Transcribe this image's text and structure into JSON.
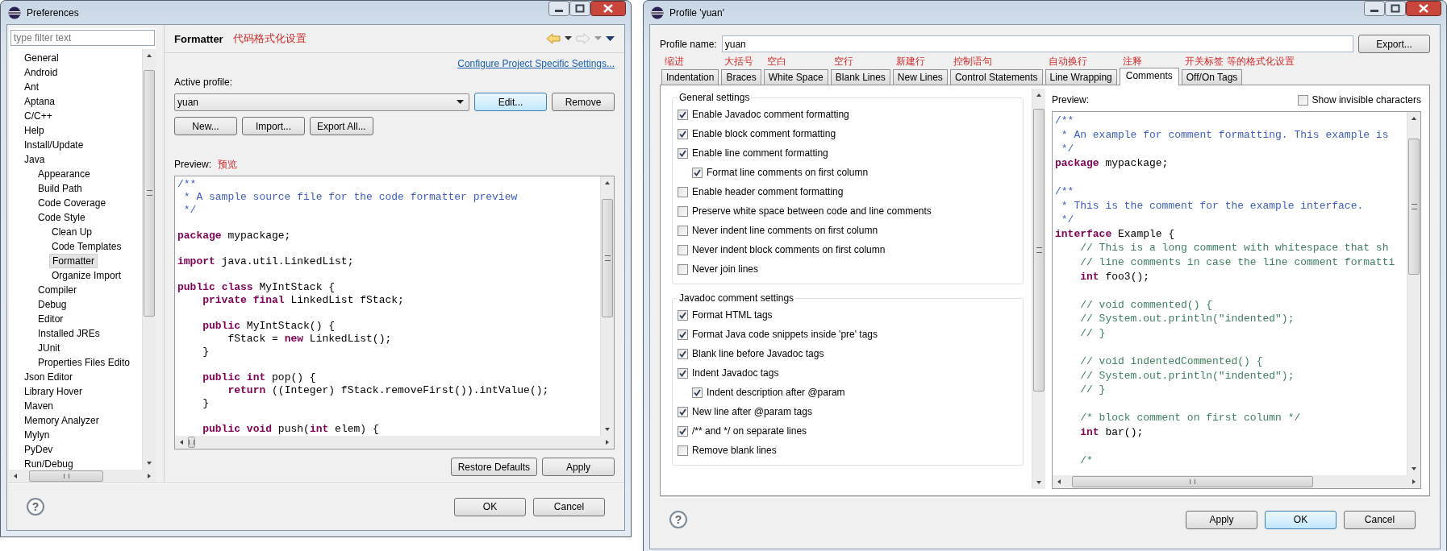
{
  "preferences": {
    "window": {
      "title": "Preferences"
    },
    "filter": {
      "placeholder": "type filter text"
    },
    "tree": [
      {
        "label": "General",
        "selected": false
      },
      {
        "label": "Android",
        "selected": false
      },
      {
        "label": "Ant",
        "selected": false
      },
      {
        "label": "Aptana",
        "selected": false
      },
      {
        "label": "C/C++",
        "selected": false
      },
      {
        "label": "Help",
        "selected": false
      },
      {
        "label": "Install/Update",
        "selected": false
      },
      {
        "label": "Java",
        "selected": false,
        "children": [
          {
            "label": "Appearance",
            "selected": false
          },
          {
            "label": "Build Path",
            "selected": false
          },
          {
            "label": "Code Coverage",
            "selected": false
          },
          {
            "label": "Code Style",
            "selected": false,
            "children": [
              {
                "label": "Clean Up",
                "selected": false
              },
              {
                "label": "Code Templates",
                "selected": false
              },
              {
                "label": "Formatter",
                "selected": true
              },
              {
                "label": "Organize Import",
                "selected": false
              }
            ]
          },
          {
            "label": "Compiler",
            "selected": false
          },
          {
            "label": "Debug",
            "selected": false
          },
          {
            "label": "Editor",
            "selected": false
          },
          {
            "label": "Installed JREs",
            "selected": false
          },
          {
            "label": "JUnit",
            "selected": false
          },
          {
            "label": "Properties Files Edito",
            "selected": false
          }
        ]
      },
      {
        "label": "Json Editor",
        "selected": false
      },
      {
        "label": "Library Hover",
        "selected": false
      },
      {
        "label": "Maven",
        "selected": false
      },
      {
        "label": "Memory Analyzer",
        "selected": false
      },
      {
        "label": "Mylyn",
        "selected": false
      },
      {
        "label": "PyDev",
        "selected": false
      },
      {
        "label": "Run/Debug",
        "selected": false
      }
    ],
    "page": {
      "title": "Formatter",
      "annotation": "代码格式化设置",
      "link": "Configure Project Specific Settings...",
      "profile_label": "Active profile:",
      "profile": "yuan",
      "profile_buttons": [
        {
          "label": "Edit...",
          "focused": true
        },
        {
          "label": "Remove",
          "focused": false
        }
      ],
      "manage_buttons": [
        "New...",
        "Import...",
        "Export All..."
      ],
      "preview_label": "Preview:",
      "preview_annotation": "预览",
      "code": [
        {
          "kind": "javadoc",
          "text": "/**"
        },
        {
          "kind": "javadoc",
          "text": " * A sample source file for the code formatter preview"
        },
        {
          "kind": "javadoc",
          "text": " */"
        },
        {
          "kind": "blank"
        },
        {
          "kind": "code",
          "text": "**package** mypackage;"
        },
        {
          "kind": "blank"
        },
        {
          "kind": "code",
          "text": "**import** java.util.LinkedList;"
        },
        {
          "kind": "blank"
        },
        {
          "kind": "code",
          "text": "**public** **class** MyIntStack {"
        },
        {
          "kind": "code",
          "text": "    **private** **final** LinkedList fStack;"
        },
        {
          "kind": "blank"
        },
        {
          "kind": "code",
          "text": "    **public** MyIntStack() {"
        },
        {
          "kind": "code",
          "text": "        fStack = **new** LinkedList();"
        },
        {
          "kind": "code",
          "text": "    }"
        },
        {
          "kind": "blank"
        },
        {
          "kind": "code",
          "text": "    **public** **int** pop() {"
        },
        {
          "kind": "code",
          "text": "        **return** ((Integer) fStack.removeFirst()).intValue();"
        },
        {
          "kind": "code",
          "text": "    }"
        },
        {
          "kind": "blank"
        },
        {
          "kind": "code",
          "text": "    **public** **void** push(**int** elem) {"
        }
      ],
      "buttons": [
        "Restore Defaults",
        "Apply"
      ]
    },
    "help": "?",
    "footer_buttons": [
      "OK",
      "Cancel"
    ]
  },
  "profile_dialog": {
    "window": {
      "title": "Profile 'yuan'"
    },
    "profile_name_label": "Profile name:",
    "profile_name": "yuan",
    "export_button": "Export...",
    "tabs": [
      {
        "label": "Indentation",
        "annotation": "缩进",
        "selected": false
      },
      {
        "label": "Braces",
        "annotation": "大括号",
        "selected": false
      },
      {
        "label": "White Space",
        "annotation": "空白",
        "selected": false
      },
      {
        "label": "Blank Lines",
        "annotation": "空行",
        "selected": false
      },
      {
        "label": "New Lines",
        "annotation": "新建行",
        "selected": false
      },
      {
        "label": "Control Statements",
        "annotation": "控制语句",
        "selected": false
      },
      {
        "label": "Line Wrapping",
        "annotation": "自动换行",
        "selected": false
      },
      {
        "label": "Comments",
        "annotation": "注释",
        "selected": true
      },
      {
        "label": "Off/On Tags",
        "annotation": "开关标签 等的格式化设置",
        "selected": false
      }
    ],
    "groups": [
      {
        "title": "General settings",
        "options": [
          {
            "label": "Enable Javadoc comment formatting",
            "checked": true
          },
          {
            "label": "Enable block comment formatting",
            "checked": true
          },
          {
            "label": "Enable line comment formatting",
            "checked": true,
            "children": [
              {
                "label": "Format line comments on first column",
                "checked": true
              }
            ]
          },
          {
            "label": "Enable header comment formatting",
            "checked": false
          },
          {
            "label": "Preserve white space between code and line comments",
            "checked": false
          },
          {
            "label": "Never indent line comments on first column",
            "checked": false
          },
          {
            "label": "Never indent block comments on first column",
            "checked": false
          },
          {
            "label": "Never join lines",
            "checked": false
          }
        ]
      },
      {
        "title": "Javadoc comment settings",
        "options": [
          {
            "label": "Format HTML tags",
            "checked": true
          },
          {
            "label": "Format Java code snippets inside 'pre' tags",
            "checked": true
          },
          {
            "label": "Blank line before Javadoc tags",
            "checked": true
          },
          {
            "label": "Indent Javadoc tags",
            "checked": true,
            "children": [
              {
                "label": "Indent description after @param",
                "checked": true
              }
            ]
          },
          {
            "label": "New line after @param tags",
            "checked": true
          },
          {
            "label": "/** and */ on separate lines",
            "checked": true
          },
          {
            "label": "Remove blank lines",
            "checked": false
          }
        ]
      }
    ],
    "preview_label": "Preview:",
    "show_invisible": {
      "label": "Show invisible characters",
      "checked": false
    },
    "code": [
      {
        "kind": "javadoc",
        "text": "/**"
      },
      {
        "kind": "javadoc",
        "text": " * An example for comment formatting. This example is"
      },
      {
        "kind": "javadoc",
        "text": " */"
      },
      {
        "kind": "code",
        "text": "**package** mypackage;"
      },
      {
        "kind": "blank"
      },
      {
        "kind": "javadoc",
        "text": "/**"
      },
      {
        "kind": "javadoc",
        "text": " * This is the comment for the example interface."
      },
      {
        "kind": "javadoc",
        "text": " */"
      },
      {
        "kind": "code",
        "text": "**interface** Example {"
      },
      {
        "kind": "comment",
        "text": "    // This is a long comment with whitespace that sh"
      },
      {
        "kind": "comment",
        "text": "    // line comments in case the line comment formatti"
      },
      {
        "kind": "code",
        "text": "    **int** foo3();"
      },
      {
        "kind": "blank"
      },
      {
        "kind": "comment",
        "text": "    // void commented() {"
      },
      {
        "kind": "comment",
        "text": "    // System.out.println(\"indented\");"
      },
      {
        "kind": "comment",
        "text": "    // }"
      },
      {
        "kind": "blank"
      },
      {
        "kind": "comment",
        "text": "    // void indentedCommented() {"
      },
      {
        "kind": "comment",
        "text": "    // System.out.println(\"indented\");"
      },
      {
        "kind": "comment",
        "text": "    // }"
      },
      {
        "kind": "blank"
      },
      {
        "kind": "comment",
        "text": "    /* block comment on first column */"
      },
      {
        "kind": "code",
        "text": "    **int** bar();"
      },
      {
        "kind": "blank"
      },
      {
        "kind": "comment",
        "text": "    /*"
      }
    ],
    "help": "?",
    "footer_buttons": [
      {
        "label": "Apply",
        "focused": false
      },
      {
        "label": "OK",
        "focused": true
      },
      {
        "label": "Cancel",
        "focused": false
      }
    ]
  }
}
